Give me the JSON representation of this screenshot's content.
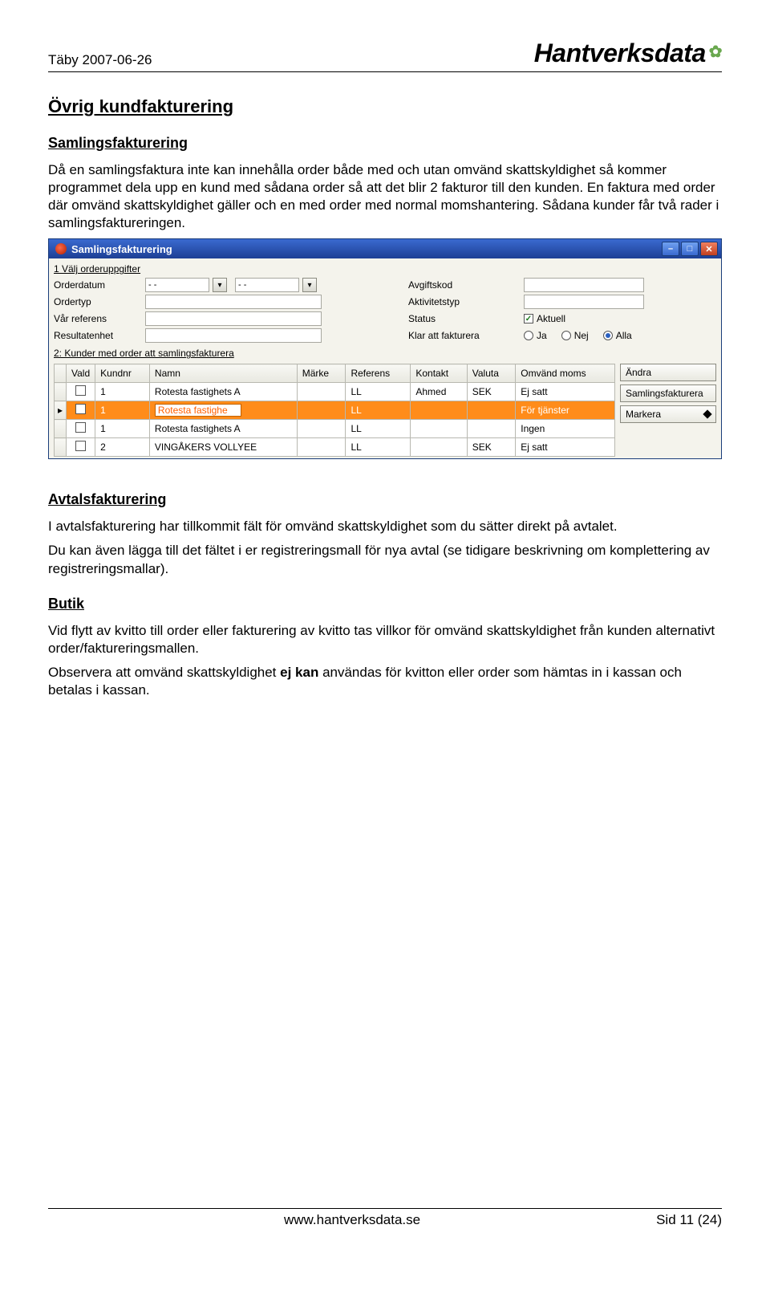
{
  "header": {
    "left": "Täby 2007-06-26",
    "brand": "Hantverksdata"
  },
  "section1": {
    "title": "Övrig kundfakturering",
    "sub1": "Samlingsfakturering",
    "p1": "Då en samlingsfaktura inte kan innehålla order både med och utan omvänd skattskyldighet så kommer programmet dela upp en kund med sådana order så att det blir 2 fakturor till den kunden. En faktura med order där omvänd skattskyldighet gäller och en med order med normal momshantering. Sådana kunder får två rader i samlingsfaktureringen."
  },
  "win": {
    "title": "Samlingsfakturering",
    "step1": "1 Välj orderuppgifter",
    "labels": {
      "orderdatum": "Orderdatum",
      "ordertyp": "Ordertyp",
      "varreferens": "Vår referens",
      "resultatenhet": "Resultatenhet",
      "avgiftskod": "Avgiftskod",
      "aktivitet": "Aktivitetstyp",
      "status": "Status",
      "aktuell": "Aktuell",
      "klar": "Klar att fakturera",
      "ja": "Ja",
      "nej": "Nej",
      "alla": "Alla",
      "date1": "- -",
      "date2": "- -"
    },
    "step2": "2: Kunder med order att samlingsfakturera",
    "columns": [
      "Vald",
      "Kundnr",
      "Namn",
      "Märke",
      "Referens",
      "Kontakt",
      "Valuta",
      "Omvänd moms"
    ],
    "rows": [
      {
        "kundnr": "1",
        "namn": "Rotesta fastighets A",
        "referens": "LL",
        "kontakt": "Ahmed",
        "valuta": "SEK",
        "omoms": "Ej satt",
        "selected": false
      },
      {
        "kundnr": "1",
        "namn": "Rotesta fastighe",
        "referens": "LL",
        "kontakt": "",
        "valuta": "",
        "omoms": "För tjänster",
        "selected": true
      },
      {
        "kundnr": "1",
        "namn": "Rotesta fastighets A",
        "referens": "LL",
        "kontakt": "",
        "valuta": "",
        "omoms": "Ingen",
        "selected": false
      },
      {
        "kundnr": "2",
        "namn": "VINGÅKERS VOLLYEE",
        "referens": "LL",
        "kontakt": "",
        "valuta": "SEK",
        "omoms": "Ej satt",
        "selected": false
      }
    ],
    "sidebtns": [
      "Ändra",
      "Samlingsfakturera",
      "Markera"
    ]
  },
  "section2": {
    "sub1": "Avtalsfakturering",
    "p1": "I avtalsfakturering har tillkommit fält för omvänd skattskyldighet som du sätter direkt på avtalet.",
    "p2": "Du kan även lägga till det fältet i er registreringsmall för nya avtal (se tidigare beskrivning om komplettering av registreringsmallar).",
    "sub2": "Butik",
    "p3": "Vid flytt av kvitto till order eller fakturering av kvitto tas villkor för omvänd skattskyldighet från kunden alternativt order/faktureringsmallen.",
    "p4a": "Observera att omvänd skattskyldighet ",
    "p4b": "ej kan",
    "p4c": " användas för kvitton eller order som hämtas in i kassan och betalas i kassan."
  },
  "footer": {
    "link": "www.hantverksdata.se",
    "page": "Sid 11 (24)"
  }
}
